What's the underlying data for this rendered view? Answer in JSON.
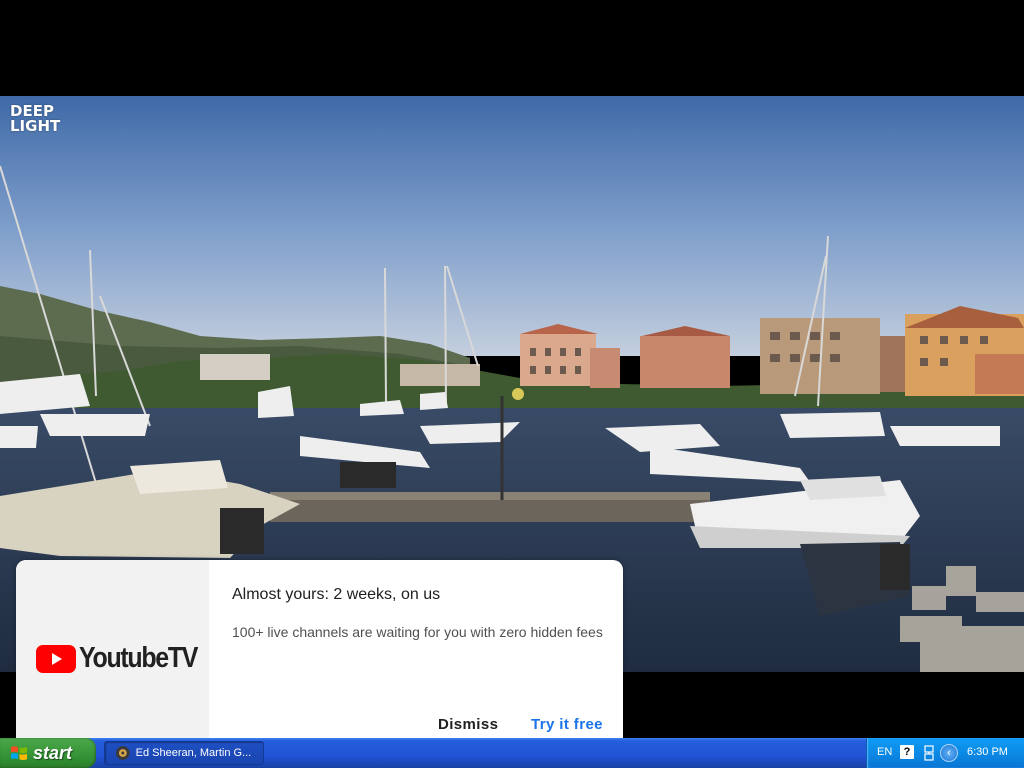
{
  "video": {
    "channel_logo": {
      "line1": "DEEP",
      "line2": "LIGHT"
    }
  },
  "promo": {
    "brand": "YoutubeTV",
    "title": "Almost yours: 2 weeks, on us",
    "body": "100+ live channels are waiting for you with zero hidden fees",
    "dismiss_label": "Dismiss",
    "try_label": "Try it free",
    "colors": {
      "accent": "#1a73e8",
      "brand_red": "#ff0000"
    }
  },
  "taskbar": {
    "start_label": "start",
    "task_item_label": "Ed Sheeran, Martin G...",
    "tray": {
      "language": "EN",
      "help_glyph": "?",
      "arrow_glyph": "‹",
      "clock": "6:30 PM"
    }
  }
}
